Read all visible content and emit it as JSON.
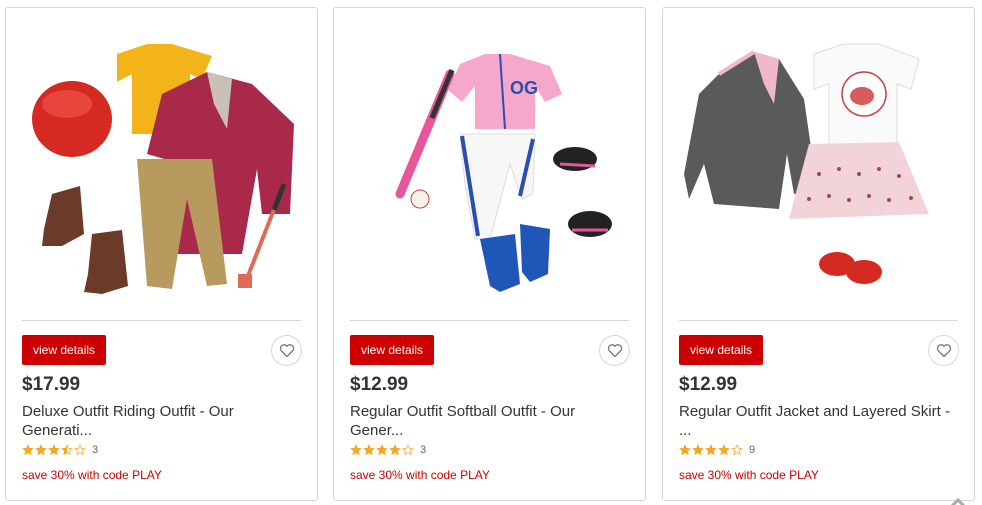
{
  "products": [
    {
      "image_alt": "Deluxe Outfit Riding Outfit",
      "button_label": "view details",
      "favorite_icon": "heart-icon",
      "price": "$17.99",
      "title_line1": "Deluxe Outfit Riding Outfit - Our",
      "title_line2": "Generati...",
      "rating": 3.5,
      "review_count": "3",
      "promo": "save 30% with code PLAY"
    },
    {
      "image_alt": "Regular Outfit Softball Outfit",
      "button_label": "view details",
      "favorite_icon": "heart-icon",
      "price": "$12.99",
      "title_line1": "Regular Outfit Softball Outfit - Our",
      "title_line2": "Gener...",
      "rating": 4,
      "review_count": "3",
      "promo": "save 30% with code PLAY"
    },
    {
      "image_alt": "Regular Outfit Jacket and Layered Skirt",
      "button_label": "view details",
      "favorite_icon": "heart-icon",
      "price": "$12.99",
      "title_line1": "Regular Outfit Jacket and Layered Skirt -",
      "title_line2": "...",
      "rating": 4,
      "review_count": "9",
      "promo": "save 30% with code PLAY"
    }
  ],
  "colors": {
    "accent": "#cc0000",
    "star": "#f5a623",
    "border": "#d6d6d6"
  }
}
